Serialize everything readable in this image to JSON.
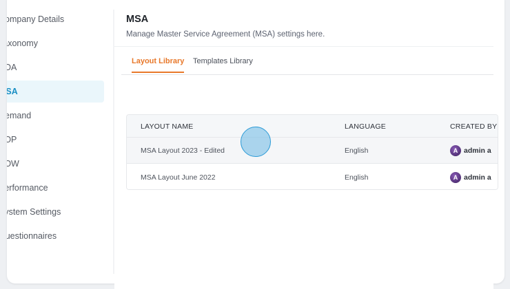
{
  "sidebar": {
    "items": [
      {
        "label": "Company Details"
      },
      {
        "label": "Taxonomy"
      },
      {
        "label": "DDA"
      },
      {
        "label": "MSA"
      },
      {
        "label": "Demand"
      },
      {
        "label": "SOP"
      },
      {
        "label": "SOW"
      },
      {
        "label": "Performance"
      },
      {
        "label": "System Settings"
      },
      {
        "label": "Questionnaires"
      }
    ],
    "active_index": 3
  },
  "header": {
    "title": "MSA",
    "subtitle": "Manage Master Service Agreement (MSA) settings here."
  },
  "tabs": [
    {
      "label": "Layout Library",
      "active": true
    },
    {
      "label": "Templates Library",
      "active": false
    }
  ],
  "table": {
    "columns": [
      "LAYOUT NAME",
      "LANGUAGE",
      "CREATED BY"
    ],
    "rows": [
      {
        "layout_name": "MSA Layout 2023 - Edited",
        "language": "English",
        "created_by": "admin a"
      },
      {
        "layout_name": "MSA Layout June 2022",
        "language": "English",
        "created_by": "admin a"
      }
    ]
  },
  "colors": {
    "accent_tab": "#e8782a",
    "sidebar_active": "#1a8fc4",
    "avatar": "#5a3385"
  },
  "icons": {
    "avatar": "avatar-icon"
  }
}
